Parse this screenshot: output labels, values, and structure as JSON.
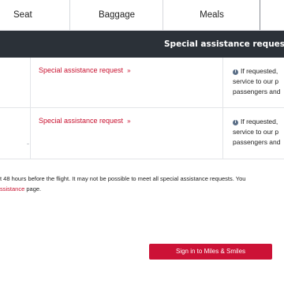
{
  "tabs": {
    "seat": "Seat",
    "baggage": "Baggage",
    "meals": "Meals"
  },
  "header": {
    "title": "Special assistance request"
  },
  "rows": [
    {
      "link": "Special assistance request",
      "chevron": "»",
      "info_lines": [
        "If requested,",
        "service to our p",
        "passengers and"
      ]
    },
    {
      "link": "Special assistance request",
      "chevron": "»",
      "info_lines": [
        "If requested,",
        "service to our p",
        "passengers and"
      ]
    }
  ],
  "note": {
    "line1": "t 48 hours before the flight. It may not be possible to meet all special assistance requests. You",
    "line2_link": "ssistance",
    "line2_rest": " page."
  },
  "signin": {
    "label": "Sign in to Miles & Smiles"
  },
  "colors": {
    "accent": "#c8102e",
    "header_bg": "#2b3138",
    "button_bg": "#cc1236",
    "info_icon": "#5b6f87"
  },
  "icons": {
    "info": "info-icon",
    "chevron": "double-chevron-right-icon"
  }
}
